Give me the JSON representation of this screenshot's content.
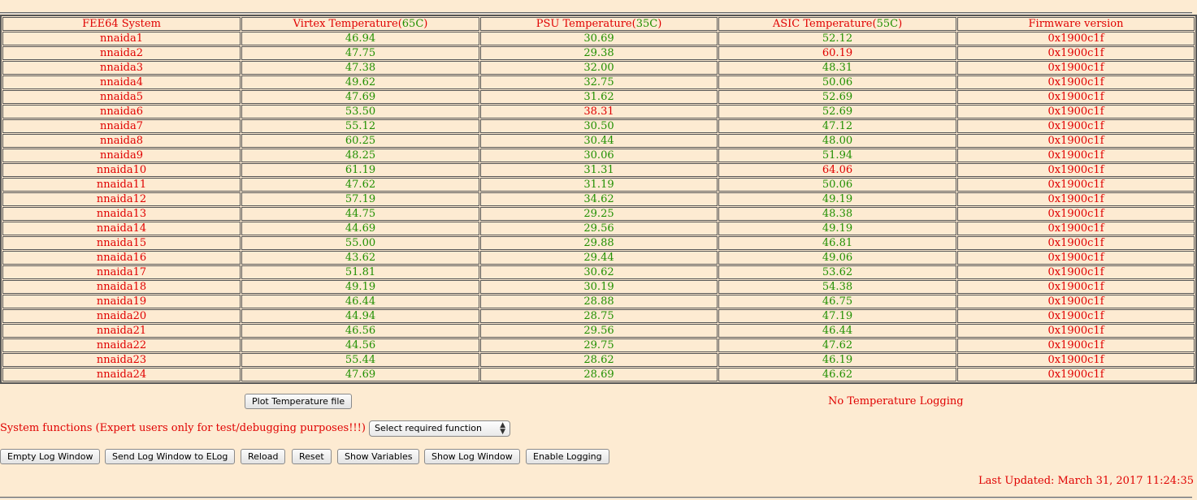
{
  "table": {
    "headers": {
      "system": "FEE64 System",
      "virtex": {
        "label": "Virtex Temperature(",
        "limit": "65C",
        "close": ")"
      },
      "psu": {
        "label": "PSU Temperature(",
        "limit": "35C",
        "close": ")"
      },
      "asic": {
        "label": "ASIC Temperature(",
        "limit": "55C",
        "close": ")"
      },
      "firmware": "Firmware version"
    },
    "rows": [
      {
        "system": "nnaida1",
        "virtex": "46.94",
        "psu": "30.69",
        "asic": "52.12",
        "firmware": "0x1900c1f"
      },
      {
        "system": "nnaida2",
        "virtex": "47.75",
        "psu": "29.38",
        "asic": "60.19",
        "firmware": "0x1900c1f"
      },
      {
        "system": "nnaida3",
        "virtex": "47.38",
        "psu": "32.00",
        "asic": "48.31",
        "firmware": "0x1900c1f"
      },
      {
        "system": "nnaida4",
        "virtex": "49.62",
        "psu": "32.75",
        "asic": "50.06",
        "firmware": "0x1900c1f"
      },
      {
        "system": "nnaida5",
        "virtex": "47.69",
        "psu": "31.62",
        "asic": "52.69",
        "firmware": "0x1900c1f"
      },
      {
        "system": "nnaida6",
        "virtex": "53.50",
        "psu": "38.31",
        "asic": "52.69",
        "firmware": "0x1900c1f"
      },
      {
        "system": "nnaida7",
        "virtex": "55.12",
        "psu": "30.50",
        "asic": "47.12",
        "firmware": "0x1900c1f"
      },
      {
        "system": "nnaida8",
        "virtex": "60.25",
        "psu": "30.44",
        "asic": "48.00",
        "firmware": "0x1900c1f"
      },
      {
        "system": "nnaida9",
        "virtex": "48.25",
        "psu": "30.06",
        "asic": "51.94",
        "firmware": "0x1900c1f"
      },
      {
        "system": "nnaida10",
        "virtex": "61.19",
        "psu": "31.31",
        "asic": "64.06",
        "firmware": "0x1900c1f"
      },
      {
        "system": "nnaida11",
        "virtex": "47.62",
        "psu": "31.19",
        "asic": "50.06",
        "firmware": "0x1900c1f"
      },
      {
        "system": "nnaida12",
        "virtex": "57.19",
        "psu": "34.62",
        "asic": "49.19",
        "firmware": "0x1900c1f"
      },
      {
        "system": "nnaida13",
        "virtex": "44.75",
        "psu": "29.25",
        "asic": "48.38",
        "firmware": "0x1900c1f"
      },
      {
        "system": "nnaida14",
        "virtex": "44.69",
        "psu": "29.56",
        "asic": "49.19",
        "firmware": "0x1900c1f"
      },
      {
        "system": "nnaida15",
        "virtex": "55.00",
        "psu": "29.88",
        "asic": "46.81",
        "firmware": "0x1900c1f"
      },
      {
        "system": "nnaida16",
        "virtex": "43.62",
        "psu": "29.44",
        "asic": "49.06",
        "firmware": "0x1900c1f"
      },
      {
        "system": "nnaida17",
        "virtex": "51.81",
        "psu": "30.62",
        "asic": "53.62",
        "firmware": "0x1900c1f"
      },
      {
        "system": "nnaida18",
        "virtex": "49.19",
        "psu": "30.19",
        "asic": "54.38",
        "firmware": "0x1900c1f"
      },
      {
        "system": "nnaida19",
        "virtex": "46.44",
        "psu": "28.88",
        "asic": "46.75",
        "firmware": "0x1900c1f"
      },
      {
        "system": "nnaida20",
        "virtex": "44.94",
        "psu": "28.75",
        "asic": "47.19",
        "firmware": "0x1900c1f"
      },
      {
        "system": "nnaida21",
        "virtex": "46.56",
        "psu": "29.56",
        "asic": "46.44",
        "firmware": "0x1900c1f"
      },
      {
        "system": "nnaida22",
        "virtex": "44.56",
        "psu": "29.75",
        "asic": "47.62",
        "firmware": "0x1900c1f"
      },
      {
        "system": "nnaida23",
        "virtex": "55.44",
        "psu": "28.62",
        "asic": "46.19",
        "firmware": "0x1900c1f"
      },
      {
        "system": "nnaida24",
        "virtex": "47.69",
        "psu": "28.69",
        "asic": "46.62",
        "firmware": "0x1900c1f"
      }
    ],
    "hot_cells": [
      {
        "row": 1,
        "col": "asic"
      },
      {
        "row": 5,
        "col": "psu"
      },
      {
        "row": 9,
        "col": "asic"
      }
    ]
  },
  "colors": {
    "ok": "#209000",
    "alarm": "#e00000",
    "background": "#fdebd2"
  },
  "controls": {
    "plot_button": "Plot Temperature file",
    "logging_status": "No Temperature Logging",
    "system_functions_label": "System functions (Expert users only for test/debugging purposes!!!)",
    "function_select": "Select required function",
    "buttons": {
      "empty_log": "Empty Log Window",
      "send_elog": "Send Log Window to ELog",
      "reload": "Reload",
      "reset": "Reset",
      "show_variables": "Show Variables",
      "show_log": "Show Log Window",
      "enable_logging": "Enable Logging"
    },
    "last_updated": "Last Updated: March 31, 2017 11:24:35"
  }
}
